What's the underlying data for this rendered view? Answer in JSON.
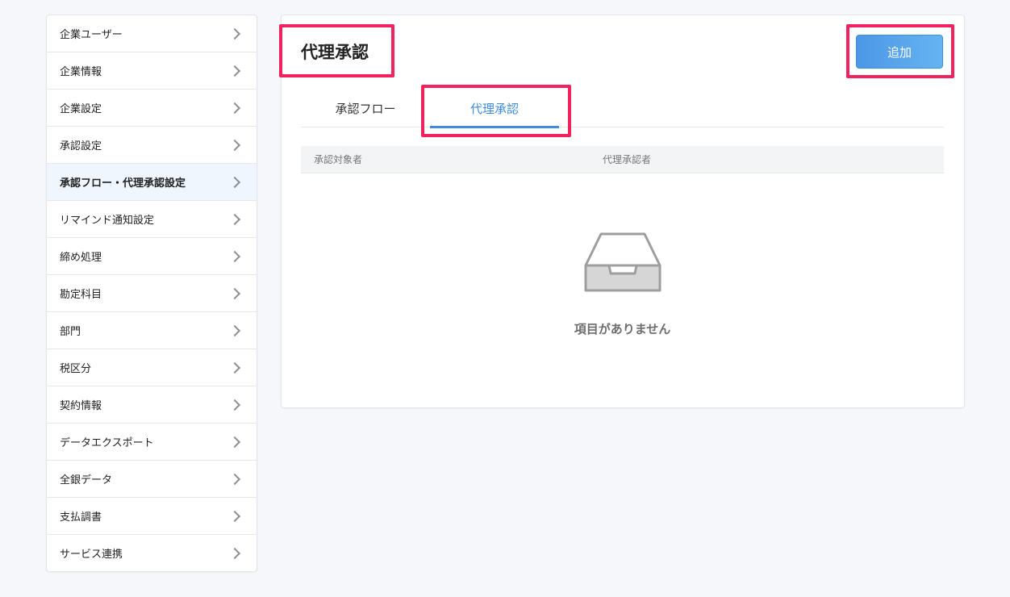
{
  "sidebar": {
    "items": [
      {
        "label": "企業ユーザー",
        "active": false
      },
      {
        "label": "企業情報",
        "active": false
      },
      {
        "label": "企業設定",
        "active": false
      },
      {
        "label": "承認設定",
        "active": false
      },
      {
        "label": "承認フロー・代理承認設定",
        "active": true
      },
      {
        "label": "リマインド通知設定",
        "active": false
      },
      {
        "label": "締め処理",
        "active": false
      },
      {
        "label": "勘定科目",
        "active": false
      },
      {
        "label": "部門",
        "active": false
      },
      {
        "label": "税区分",
        "active": false
      },
      {
        "label": "契約情報",
        "active": false
      },
      {
        "label": "データエクスポート",
        "active": false
      },
      {
        "label": "全銀データ",
        "active": false
      },
      {
        "label": "支払調書",
        "active": false
      },
      {
        "label": "サービス連携",
        "active": false
      }
    ],
    "chevron_icon": "chevron-right-icon"
  },
  "main": {
    "title": "代理承認",
    "add_button_label": "追加",
    "tabs": [
      {
        "label": "承認フロー",
        "active": false
      },
      {
        "label": "代理承認",
        "active": true
      }
    ],
    "table": {
      "columns": [
        "承認対象者",
        "代理承認者"
      ],
      "rows": []
    },
    "empty_state": {
      "icon": "inbox-tray-icon",
      "text": "項目がありません"
    }
  },
  "colors": {
    "accent": "#3d8be3",
    "button_gradient_start": "#4c97e6",
    "button_gradient_end": "#66b3f1",
    "highlight_border": "#f0215d",
    "active_sidebar_bg": "#f0f6fd",
    "page_background": "#f5f7fa"
  }
}
